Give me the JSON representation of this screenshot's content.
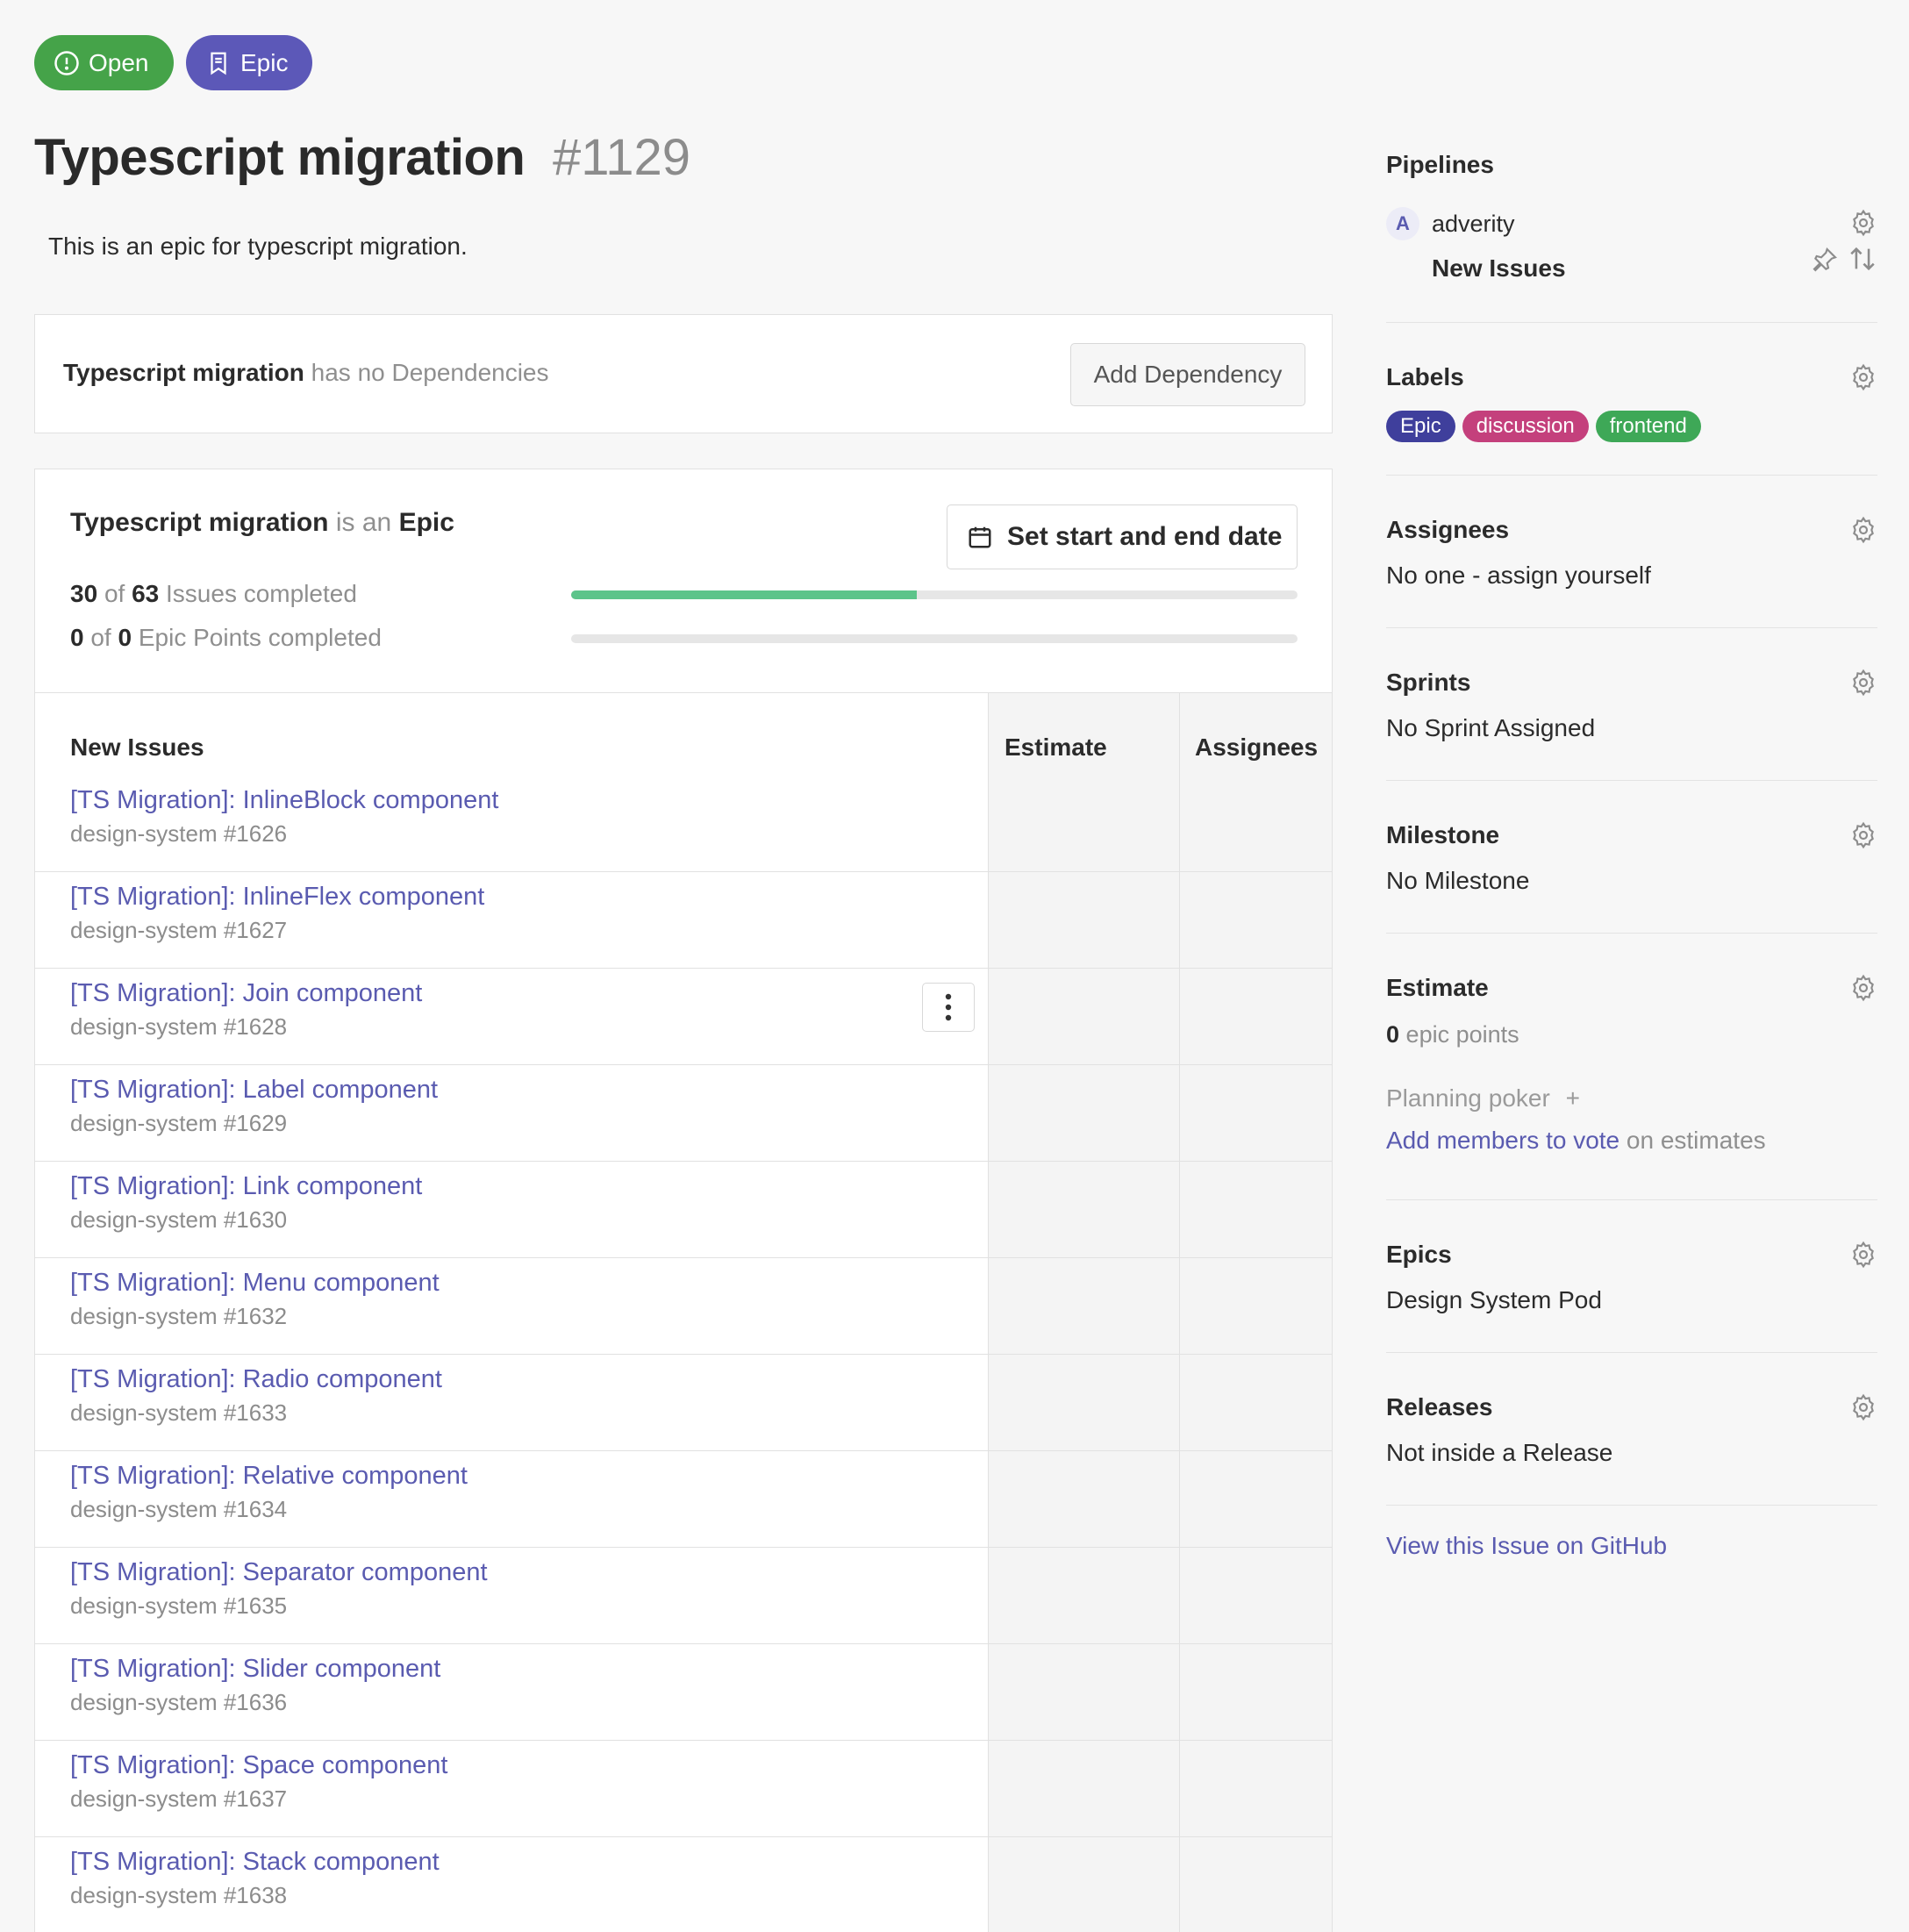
{
  "header": {
    "status_label": "Open",
    "type_label": "Epic",
    "title": "Typescript migration",
    "issue_number": "#1129",
    "description": "This is an epic for typescript migration."
  },
  "dependencies": {
    "name": "Typescript migration",
    "text": "has no Dependencies",
    "add_button": "Add Dependency"
  },
  "epic": {
    "name": "Typescript migration",
    "is_an": "is an",
    "type": "Epic",
    "set_date_button": "Set start and end date",
    "issues_done": "30",
    "of1": "of",
    "issues_total": "63",
    "issues_suffix": "Issues completed",
    "issues_progress": 0.476,
    "points_done": "0",
    "of2": "of",
    "points_total": "0",
    "points_suffix": "Epic Points completed",
    "points_progress": 0
  },
  "table": {
    "col_issues": "New Issues",
    "col_estimate": "Estimate",
    "col_assignees": "Assignees",
    "rows": [
      {
        "title": "[TS Migration]: InlineBlock component",
        "sub": "design-system #1626"
      },
      {
        "title": "[TS Migration]: InlineFlex component",
        "sub": "design-system #1627"
      },
      {
        "title": "[TS Migration]: Join component",
        "sub": "design-system #1628"
      },
      {
        "title": "[TS Migration]: Label component",
        "sub": "design-system #1629"
      },
      {
        "title": "[TS Migration]: Link component",
        "sub": "design-system #1630"
      },
      {
        "title": "[TS Migration]: Menu component",
        "sub": "design-system #1632"
      },
      {
        "title": "[TS Migration]: Radio component",
        "sub": "design-system #1633"
      },
      {
        "title": "[TS Migration]: Relative component",
        "sub": "design-system #1634"
      },
      {
        "title": "[TS Migration]: Separator component",
        "sub": "design-system #1635"
      },
      {
        "title": "[TS Migration]: Slider component",
        "sub": "design-system #1636"
      },
      {
        "title": "[TS Migration]: Space component",
        "sub": "design-system #1637"
      },
      {
        "title": "[TS Migration]: Stack component",
        "sub": "design-system #1638"
      }
    ]
  },
  "sidebar": {
    "pipelines": {
      "heading": "Pipelines",
      "avatar_letter": "A",
      "workspace": "adverity",
      "pipeline": "New Issues"
    },
    "labels": {
      "heading": "Labels",
      "items": [
        {
          "name": "Epic",
          "color": "#3f3f9c"
        },
        {
          "name": "discussion",
          "color": "#c4407c"
        },
        {
          "name": "frontend",
          "color": "#3ea857"
        }
      ]
    },
    "assignees": {
      "heading": "Assignees",
      "value": "No one - assign yourself"
    },
    "sprints": {
      "heading": "Sprints",
      "value": "No Sprint Assigned"
    },
    "milestone": {
      "heading": "Milestone",
      "value": "No Milestone"
    },
    "estimate": {
      "heading": "Estimate",
      "points": "0",
      "points_suffix": "epic points",
      "poker": "Planning poker",
      "poker_plus": "+",
      "vote_link": "Add members to vote",
      "vote_suffix": "on estimates"
    },
    "epics": {
      "heading": "Epics",
      "value": "Design System Pod"
    },
    "releases": {
      "heading": "Releases",
      "value": "Not inside a Release"
    },
    "github_link": "View this Issue on GitHub"
  },
  "colors": {
    "open": "#45a349",
    "epic": "#5c58b8",
    "link": "#5a5bb0",
    "progress": "#5cc48a"
  }
}
